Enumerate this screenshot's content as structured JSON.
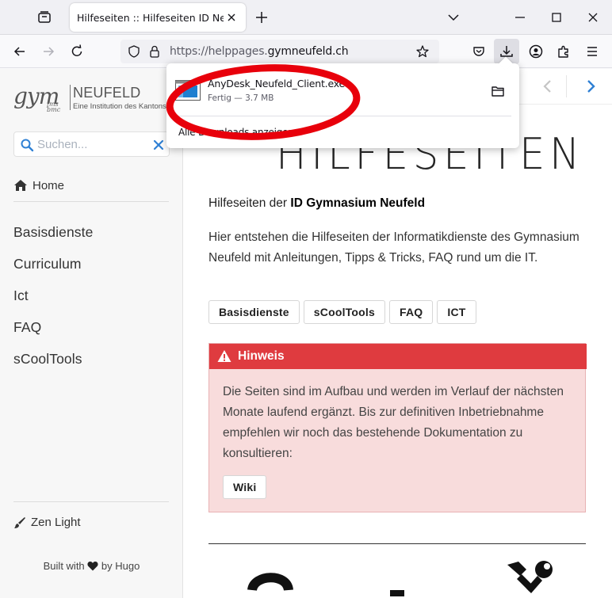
{
  "browser": {
    "tab_title": "Hilfeseiten :: Hilfeseiten ID Neufeld",
    "url_prefix": "https://helppages.",
    "url_domain": "gymneufeld.ch"
  },
  "download": {
    "filename": "AnyDesk_Neufeld_Client.exe",
    "status": "Fertig — 3.7 MB",
    "show_all": "Alle Downloads anzeigen"
  },
  "sidebar": {
    "logo_gym": "gym",
    "logo_fms": "fms\nbmc",
    "logo_name": "NEUFELD",
    "logo_sub": "Eine Institution des Kantons Bern",
    "search_placeholder": "Suchen...",
    "home": "Home",
    "items": [
      "Basisdienste",
      "Curriculum",
      "Ict",
      "FAQ",
      "sCoolTools"
    ],
    "zen": "Zen Light",
    "built_prefix": "Built with",
    "built_suffix": "by Hugo"
  },
  "main": {
    "title": "HILFESEITEN",
    "intro_prefix": "Hilfeseiten der",
    "intro_bold": "ID Gymnasium Neufeld",
    "description": "Hier entstehen die Hilfeseiten der Informatikdienste des Gymnasium Neufeld mit Anleitungen, Tipps & Tricks, FAQ rund um die IT.",
    "buttons": [
      "Basisdienste",
      "sCoolTools",
      "FAQ",
      "ICT"
    ],
    "notice": {
      "title": "Hinweis",
      "text": "Die Seiten sind im Aufbau und werden im Verlauf der nächsten Monate laufend ergänzt. Bis zur definitiven Inbetriebnahme empfehlen wir noch das bestehende Dokumentation zu konsultieren:",
      "button": "Wiki"
    }
  },
  "colors": {
    "accent_blue": "#2f80d4",
    "notice_red": "#df3b3f",
    "notice_bg": "#f8dcdc",
    "annotation_red": "#e8000b"
  }
}
